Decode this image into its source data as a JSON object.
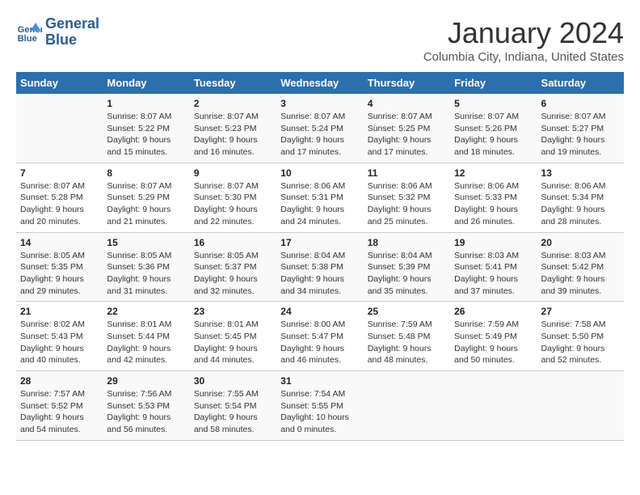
{
  "logo": {
    "line1": "General",
    "line2": "Blue"
  },
  "title": "January 2024",
  "subtitle": "Columbia City, Indiana, United States",
  "days_of_week": [
    "Sunday",
    "Monday",
    "Tuesday",
    "Wednesday",
    "Thursday",
    "Friday",
    "Saturday"
  ],
  "weeks": [
    [
      {
        "day": "",
        "info": ""
      },
      {
        "day": "1",
        "info": "Sunrise: 8:07 AM\nSunset: 5:22 PM\nDaylight: 9 hours\nand 15 minutes."
      },
      {
        "day": "2",
        "info": "Sunrise: 8:07 AM\nSunset: 5:23 PM\nDaylight: 9 hours\nand 16 minutes."
      },
      {
        "day": "3",
        "info": "Sunrise: 8:07 AM\nSunset: 5:24 PM\nDaylight: 9 hours\nand 17 minutes."
      },
      {
        "day": "4",
        "info": "Sunrise: 8:07 AM\nSunset: 5:25 PM\nDaylight: 9 hours\nand 17 minutes."
      },
      {
        "day": "5",
        "info": "Sunrise: 8:07 AM\nSunset: 5:26 PM\nDaylight: 9 hours\nand 18 minutes."
      },
      {
        "day": "6",
        "info": "Sunrise: 8:07 AM\nSunset: 5:27 PM\nDaylight: 9 hours\nand 19 minutes."
      }
    ],
    [
      {
        "day": "7",
        "info": "Sunrise: 8:07 AM\nSunset: 5:28 PM\nDaylight: 9 hours\nand 20 minutes."
      },
      {
        "day": "8",
        "info": "Sunrise: 8:07 AM\nSunset: 5:29 PM\nDaylight: 9 hours\nand 21 minutes."
      },
      {
        "day": "9",
        "info": "Sunrise: 8:07 AM\nSunset: 5:30 PM\nDaylight: 9 hours\nand 22 minutes."
      },
      {
        "day": "10",
        "info": "Sunrise: 8:06 AM\nSunset: 5:31 PM\nDaylight: 9 hours\nand 24 minutes."
      },
      {
        "day": "11",
        "info": "Sunrise: 8:06 AM\nSunset: 5:32 PM\nDaylight: 9 hours\nand 25 minutes."
      },
      {
        "day": "12",
        "info": "Sunrise: 8:06 AM\nSunset: 5:33 PM\nDaylight: 9 hours\nand 26 minutes."
      },
      {
        "day": "13",
        "info": "Sunrise: 8:06 AM\nSunset: 5:34 PM\nDaylight: 9 hours\nand 28 minutes."
      }
    ],
    [
      {
        "day": "14",
        "info": "Sunrise: 8:05 AM\nSunset: 5:35 PM\nDaylight: 9 hours\nand 29 minutes."
      },
      {
        "day": "15",
        "info": "Sunrise: 8:05 AM\nSunset: 5:36 PM\nDaylight: 9 hours\nand 31 minutes."
      },
      {
        "day": "16",
        "info": "Sunrise: 8:05 AM\nSunset: 5:37 PM\nDaylight: 9 hours\nand 32 minutes."
      },
      {
        "day": "17",
        "info": "Sunrise: 8:04 AM\nSunset: 5:38 PM\nDaylight: 9 hours\nand 34 minutes."
      },
      {
        "day": "18",
        "info": "Sunrise: 8:04 AM\nSunset: 5:39 PM\nDaylight: 9 hours\nand 35 minutes."
      },
      {
        "day": "19",
        "info": "Sunrise: 8:03 AM\nSunset: 5:41 PM\nDaylight: 9 hours\nand 37 minutes."
      },
      {
        "day": "20",
        "info": "Sunrise: 8:03 AM\nSunset: 5:42 PM\nDaylight: 9 hours\nand 39 minutes."
      }
    ],
    [
      {
        "day": "21",
        "info": "Sunrise: 8:02 AM\nSunset: 5:43 PM\nDaylight: 9 hours\nand 40 minutes."
      },
      {
        "day": "22",
        "info": "Sunrise: 8:01 AM\nSunset: 5:44 PM\nDaylight: 9 hours\nand 42 minutes."
      },
      {
        "day": "23",
        "info": "Sunrise: 8:01 AM\nSunset: 5:45 PM\nDaylight: 9 hours\nand 44 minutes."
      },
      {
        "day": "24",
        "info": "Sunrise: 8:00 AM\nSunset: 5:47 PM\nDaylight: 9 hours\nand 46 minutes."
      },
      {
        "day": "25",
        "info": "Sunrise: 7:59 AM\nSunset: 5:48 PM\nDaylight: 9 hours\nand 48 minutes."
      },
      {
        "day": "26",
        "info": "Sunrise: 7:59 AM\nSunset: 5:49 PM\nDaylight: 9 hours\nand 50 minutes."
      },
      {
        "day": "27",
        "info": "Sunrise: 7:58 AM\nSunset: 5:50 PM\nDaylight: 9 hours\nand 52 minutes."
      }
    ],
    [
      {
        "day": "28",
        "info": "Sunrise: 7:57 AM\nSunset: 5:52 PM\nDaylight: 9 hours\nand 54 minutes."
      },
      {
        "day": "29",
        "info": "Sunrise: 7:56 AM\nSunset: 5:53 PM\nDaylight: 9 hours\nand 56 minutes."
      },
      {
        "day": "30",
        "info": "Sunrise: 7:55 AM\nSunset: 5:54 PM\nDaylight: 9 hours\nand 58 minutes."
      },
      {
        "day": "31",
        "info": "Sunrise: 7:54 AM\nSunset: 5:55 PM\nDaylight: 10 hours\nand 0 minutes."
      },
      {
        "day": "",
        "info": ""
      },
      {
        "day": "",
        "info": ""
      },
      {
        "day": "",
        "info": ""
      }
    ]
  ]
}
